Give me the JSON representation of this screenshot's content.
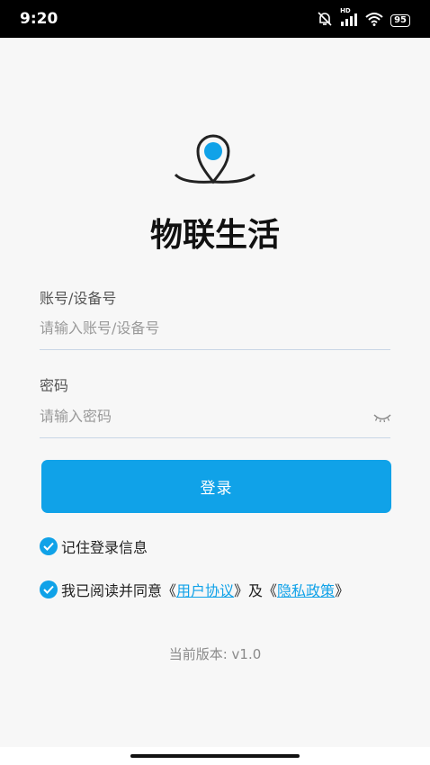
{
  "status_bar": {
    "time": "9:20",
    "battery": "95",
    "network": "HD",
    "icons": [
      "mute-icon",
      "signal-icon",
      "wifi-icon",
      "battery-icon"
    ]
  },
  "app": {
    "title": "物联生活",
    "logo_icon": "location-pin-icon",
    "accent": "#10a2e8"
  },
  "form": {
    "account_label": "账号/设备号",
    "account_placeholder": "请输入账号/设备号",
    "password_label": "密码",
    "password_placeholder": "请输入密码",
    "password_toggle_icon": "eye-closed-icon",
    "login_button": "登录"
  },
  "options": {
    "remember": "记住登录信息",
    "remember_checked": true,
    "agree_prefix": "我已阅读并同意《",
    "user_agreement": "用户协议",
    "agree_middle": "》及《",
    "privacy_policy": "隐私政策",
    "agree_suffix": "》",
    "agree_checked": true
  },
  "footer": {
    "version": "当前版本: v1.0"
  }
}
